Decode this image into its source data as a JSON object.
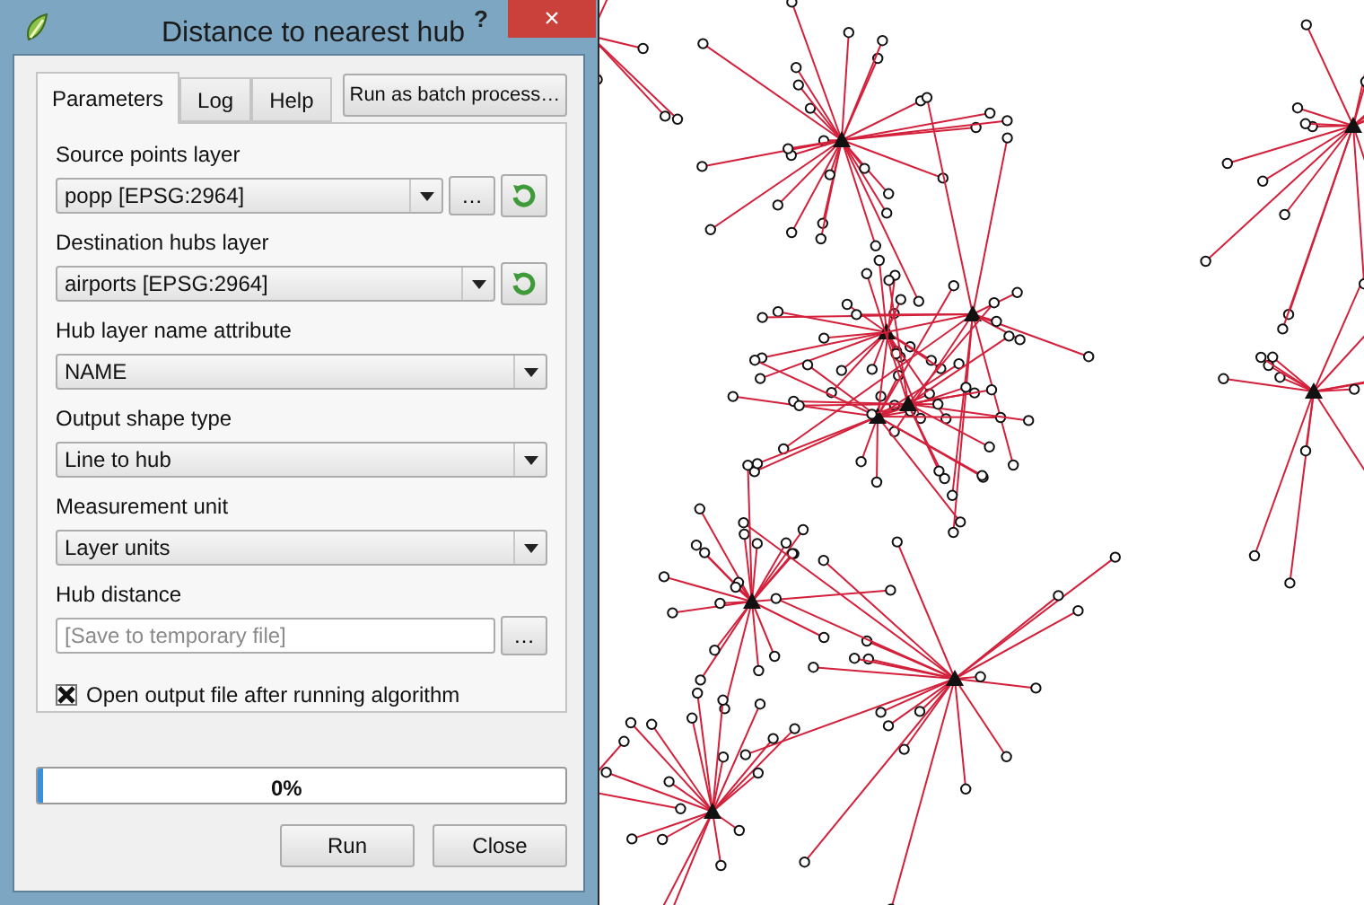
{
  "window": {
    "title": "Distance to nearest hub",
    "help_button": "?",
    "close_button": "×"
  },
  "tabs": [
    {
      "label": "Parameters",
      "selected": true
    },
    {
      "label": "Log",
      "selected": false
    },
    {
      "label": "Help",
      "selected": false
    }
  ],
  "batch_button": "Run as batch process…",
  "parameters": [
    {
      "kind": "combo",
      "label": "Source points layer",
      "value": "popp [EPSG:2964]",
      "browse_button": "…",
      "refresh_button": true
    },
    {
      "kind": "combo",
      "label": "Destination hubs layer",
      "value": "airports [EPSG:2964]",
      "refresh_button": true
    },
    {
      "kind": "combo",
      "label": "Hub layer name attribute",
      "value": "NAME"
    },
    {
      "kind": "combo",
      "label": "Output shape type",
      "value": "Line to hub"
    },
    {
      "kind": "combo",
      "label": "Measurement unit",
      "value": "Layer units"
    },
    {
      "kind": "output",
      "label": "Hub distance",
      "placeholder": "[Save to temporary file]",
      "browse_button": "…"
    },
    {
      "kind": "checkbox",
      "label": "Open output file after running algorithm",
      "checked": true
    }
  ],
  "progress": {
    "level": 0.01,
    "text": "0%"
  },
  "buttons": [
    "Run",
    "Close"
  ]
}
